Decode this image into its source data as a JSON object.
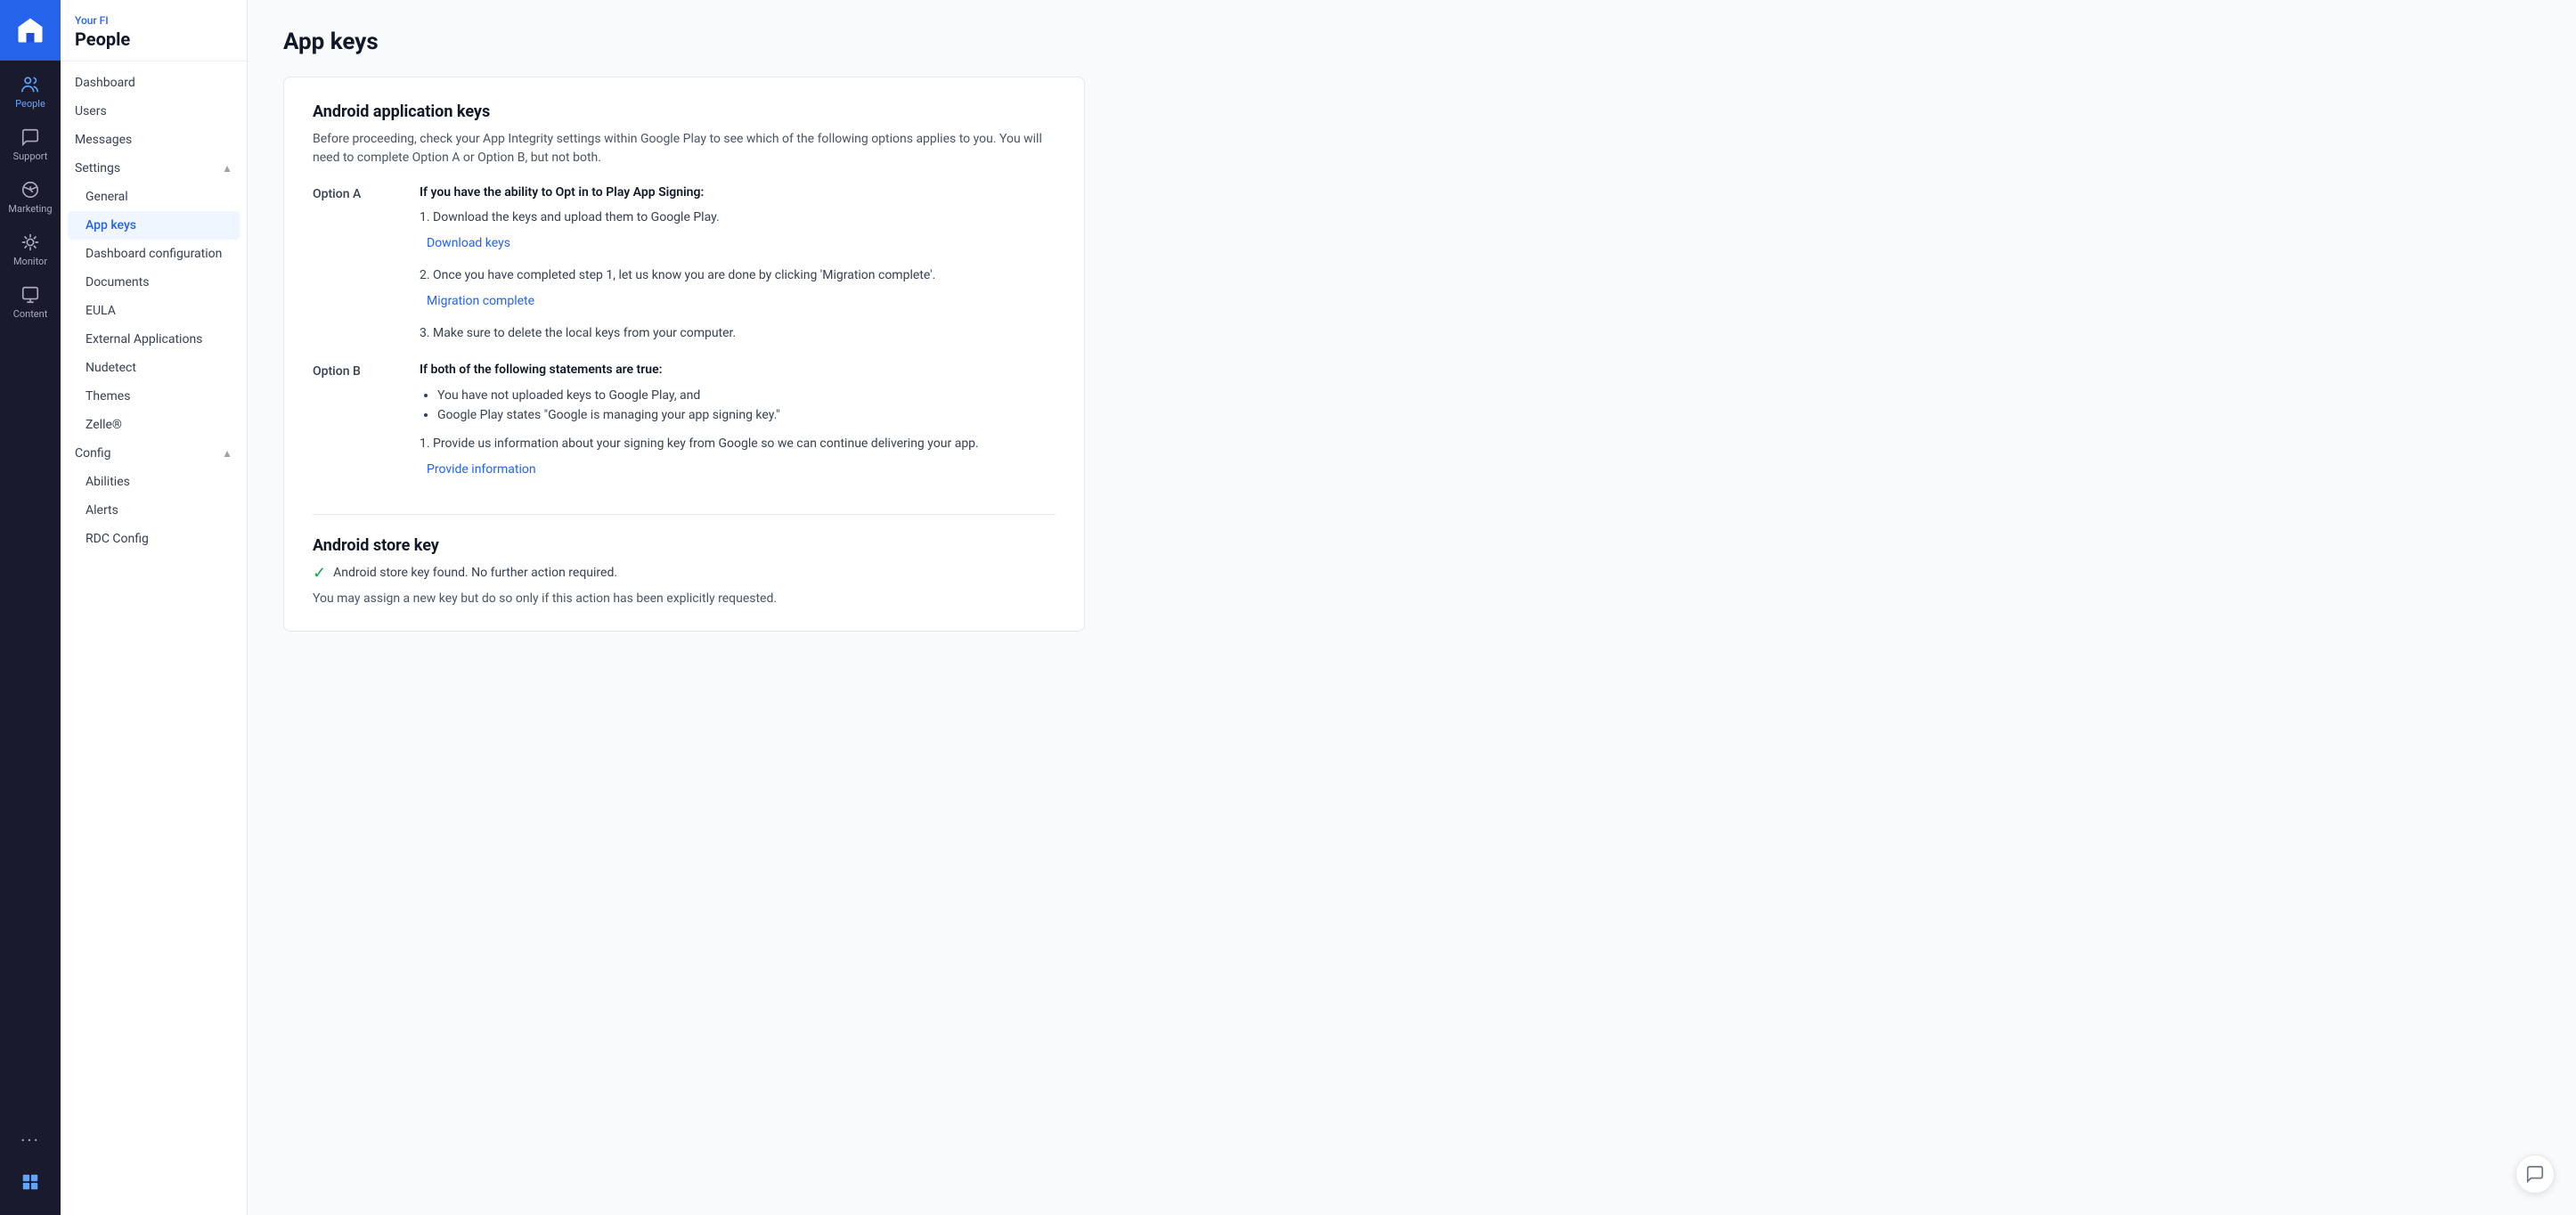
{
  "iconBar": {
    "logo": "building-icon",
    "items": [
      {
        "id": "people",
        "label": "People",
        "active": true
      },
      {
        "id": "support",
        "label": "Support",
        "active": false
      },
      {
        "id": "marketing",
        "label": "Marketing",
        "active": false
      },
      {
        "id": "monitor",
        "label": "Monitor",
        "active": false
      },
      {
        "id": "content",
        "label": "Content",
        "active": false
      }
    ],
    "bottomItems": [
      {
        "id": "more",
        "label": "..."
      },
      {
        "id": "puzzle",
        "label": ""
      }
    ]
  },
  "sidebar": {
    "fiLabel": "Your FI",
    "title": "People",
    "navItems": [
      {
        "id": "dashboard",
        "label": "Dashboard",
        "active": false
      },
      {
        "id": "users",
        "label": "Users",
        "active": false
      },
      {
        "id": "messages",
        "label": "Messages",
        "active": false
      }
    ],
    "settingsSection": {
      "label": "Settings",
      "expanded": true,
      "subItems": [
        {
          "id": "general",
          "label": "General",
          "active": false
        },
        {
          "id": "app-keys",
          "label": "App keys",
          "active": true
        },
        {
          "id": "dashboard-configuration",
          "label": "Dashboard configuration",
          "active": false
        },
        {
          "id": "documents",
          "label": "Documents",
          "active": false
        },
        {
          "id": "eula",
          "label": "EULA",
          "active": false
        },
        {
          "id": "external-applications",
          "label": "External Applications",
          "active": false
        },
        {
          "id": "nudetect",
          "label": "Nudetect",
          "active": false
        },
        {
          "id": "themes",
          "label": "Themes",
          "active": false
        },
        {
          "id": "zelle",
          "label": "Zelle®",
          "active": false
        }
      ]
    },
    "configSection": {
      "label": "Config",
      "expanded": true,
      "subItems": [
        {
          "id": "abilities",
          "label": "Abilities",
          "active": false
        },
        {
          "id": "alerts",
          "label": "Alerts",
          "active": false
        },
        {
          "id": "rdc-config",
          "label": "RDC Config",
          "active": false
        }
      ]
    }
  },
  "page": {
    "title": "App keys",
    "androidSection": {
      "title": "Android application keys",
      "description": "Before proceeding, check your App Integrity settings within Google Play to see which of the following options applies to you. You will need to complete Option A or Option B, but not both.",
      "optionA": {
        "label": "Option A",
        "heading": "If you have the ability to Opt in to Play App Signing:",
        "steps": [
          {
            "number": "1.",
            "text": "Download the keys and upload them to Google Play.",
            "linkText": "Download keys",
            "linkId": "download-keys"
          },
          {
            "number": "2.",
            "text": "Once you have completed step 1, let us know you are done by clicking 'Migration complete'.",
            "linkText": "Migration complete",
            "linkId": "migration-complete"
          },
          {
            "number": "3.",
            "text": "Make sure to delete the local keys from your computer.",
            "linkText": null
          }
        ]
      },
      "optionB": {
        "label": "Option B",
        "heading": "If both of the following statements are true:",
        "bullets": [
          "You have not uploaded keys to Google Play, and",
          "Google Play states \"Google is managing your app signing key.\""
        ],
        "steps": [
          {
            "number": "1.",
            "text": "Provide us information about your signing key from Google so we can continue delivering your app.",
            "linkText": "Provide information",
            "linkId": "provide-information"
          }
        ]
      }
    },
    "androidStoreSection": {
      "title": "Android store key",
      "successText": "Android store key found. No further action required.",
      "additionalText": "You may assign a new key but do so only if this action has been explicitly requested."
    }
  }
}
